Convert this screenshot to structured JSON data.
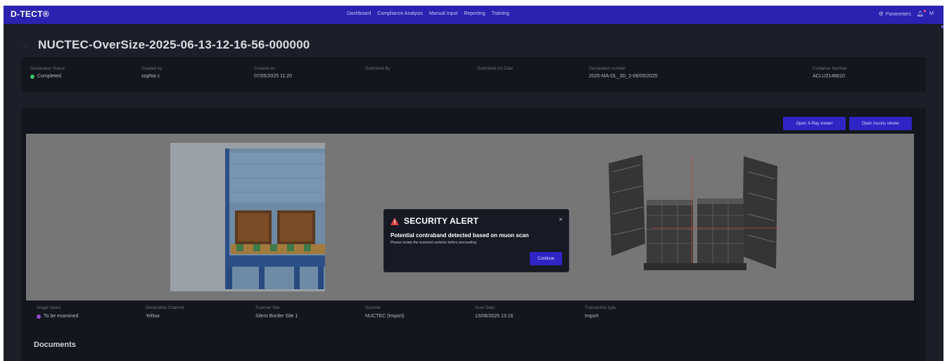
{
  "app": {
    "brand": "D-TECT®"
  },
  "nav": {
    "items": [
      "Dashboard",
      "Compliance Analysis",
      "Manual Input",
      "Reporting",
      "Training"
    ],
    "parameters_label": "Parameters",
    "user_initial": "M"
  },
  "header": {
    "title": "NUCTEC-OverSize-2025-06-13-12-16-56-000000"
  },
  "declaration": {
    "status_label": "Declaration Status",
    "status_value": "Completed",
    "created_by_label": "Created by",
    "created_by_value": "sophia c",
    "created_on_label": "Created on",
    "created_on_value": "07/05/2025 11:20",
    "submitted_by_label": "Submitted By",
    "submitted_by_value": "",
    "submitted_on_label": "Submitted On Date",
    "submitted_on_value": "",
    "number_label": "Declaration number",
    "number_value": "2025-MA-DL_3D_2-06/05/2025",
    "container_label": "Container Number",
    "container_value": "ACLU2146610"
  },
  "scan": {
    "open_xray_label": "Open X-Ray viewer",
    "open_muon_label": "Open muons viewer",
    "image_status_label": "Image status",
    "image_status_value": "To be examined",
    "channel_label": "Declaration Channel",
    "channel_value": "Yellow",
    "site_label": "Scanner Site",
    "site_value": "Silent Border Site 1",
    "scanner_label": "Scanner",
    "scanner_value": "NUCTEC (Import)",
    "date_label": "Scan Date",
    "date_value": "13/06/2025 13:16",
    "transaction_label": "Transaction type",
    "transaction_value": "Import"
  },
  "alert": {
    "title": "SECURITY ALERT",
    "message": "Potential contraband detected based on muon scan",
    "sub_message": "Please review the scanned contents before proceeding.",
    "continue_label": "Continue",
    "close_glyph": "×"
  },
  "documents": {
    "heading": "Documents"
  },
  "colors": {
    "topbar": "#2a22b0",
    "background": "#1d1f28",
    "card": "#14161d",
    "accent_button": "#2f24c4",
    "status_completed": "#37c46a",
    "status_to_be_examined": "#9b46d1",
    "alert_icon": "#e03b3b"
  },
  "icons": {
    "parameters": "gear-icon",
    "notifications": "bell-icon",
    "back": "arrow-left-icon",
    "alert": "warning-triangle-icon",
    "close": "close-icon"
  }
}
